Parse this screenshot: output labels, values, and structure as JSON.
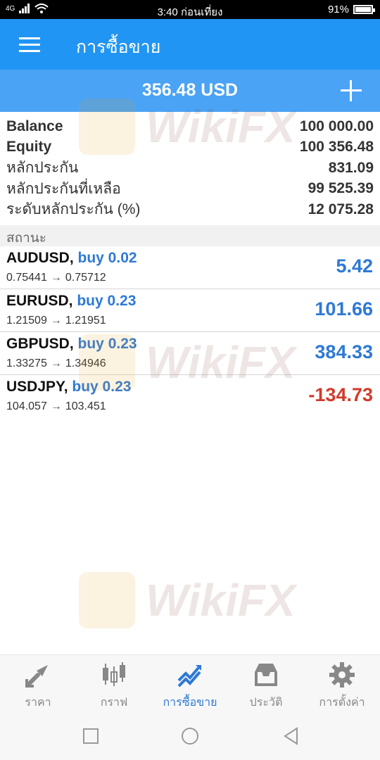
{
  "status_bar": {
    "network": "4G",
    "time": "3:40 ก่อนเที่ยง",
    "battery": "91%"
  },
  "header": {
    "title": "การซื้อขาย",
    "menu_icon": "hamburger-menu-icon"
  },
  "profit_bar": {
    "total": "356.48 USD",
    "add_icon": "plus-icon"
  },
  "summary": [
    {
      "label": "Balance",
      "value": "100 000.00"
    },
    {
      "label": "Equity",
      "value": "100 356.48"
    },
    {
      "label": "หลักประกัน",
      "value": "831.09"
    },
    {
      "label": "หลักประกันที่เหลือ",
      "value": "99 525.39"
    },
    {
      "label": "ระดับหลักประกัน (%)",
      "value": "12 075.28"
    }
  ],
  "positions_header": "สถานะ",
  "positions": [
    {
      "symbol": "AUDUSD,",
      "type": "buy 0.02",
      "open": "0.75441",
      "arrow": "→",
      "current": "0.75712",
      "profit": "5.42"
    },
    {
      "symbol": "EURUSD,",
      "type": "buy 0.23",
      "open": "1.21509",
      "arrow": "→",
      "current": "1.21951",
      "profit": "101.66"
    },
    {
      "symbol": "GBPUSD,",
      "type": "buy 0.23",
      "open": "1.33275",
      "arrow": "→",
      "current": "1.34946",
      "profit": "384.33"
    },
    {
      "symbol": "USDJPY,",
      "type": "buy 0.23",
      "open": "104.057",
      "arrow": "→",
      "current": "103.451",
      "profit": "-134.73"
    }
  ],
  "watermark_text": "WikiFX",
  "bottom_nav": [
    {
      "label": "ราคา",
      "icon": "quotes-arrows-icon"
    },
    {
      "label": "กราฟ",
      "icon": "candlestick-chart-icon"
    },
    {
      "label": "การซื้อขาย",
      "icon": "trade-chart-icon"
    },
    {
      "label": "ประวัติ",
      "icon": "history-inbox-icon"
    },
    {
      "label": "การตั้งค่า",
      "icon": "gear-icon"
    }
  ],
  "colors": {
    "header_blue": "#2195f3",
    "profit_bar_blue": "#4aa3f5",
    "positive": "#2d79d6",
    "negative": "#d23a2a"
  }
}
